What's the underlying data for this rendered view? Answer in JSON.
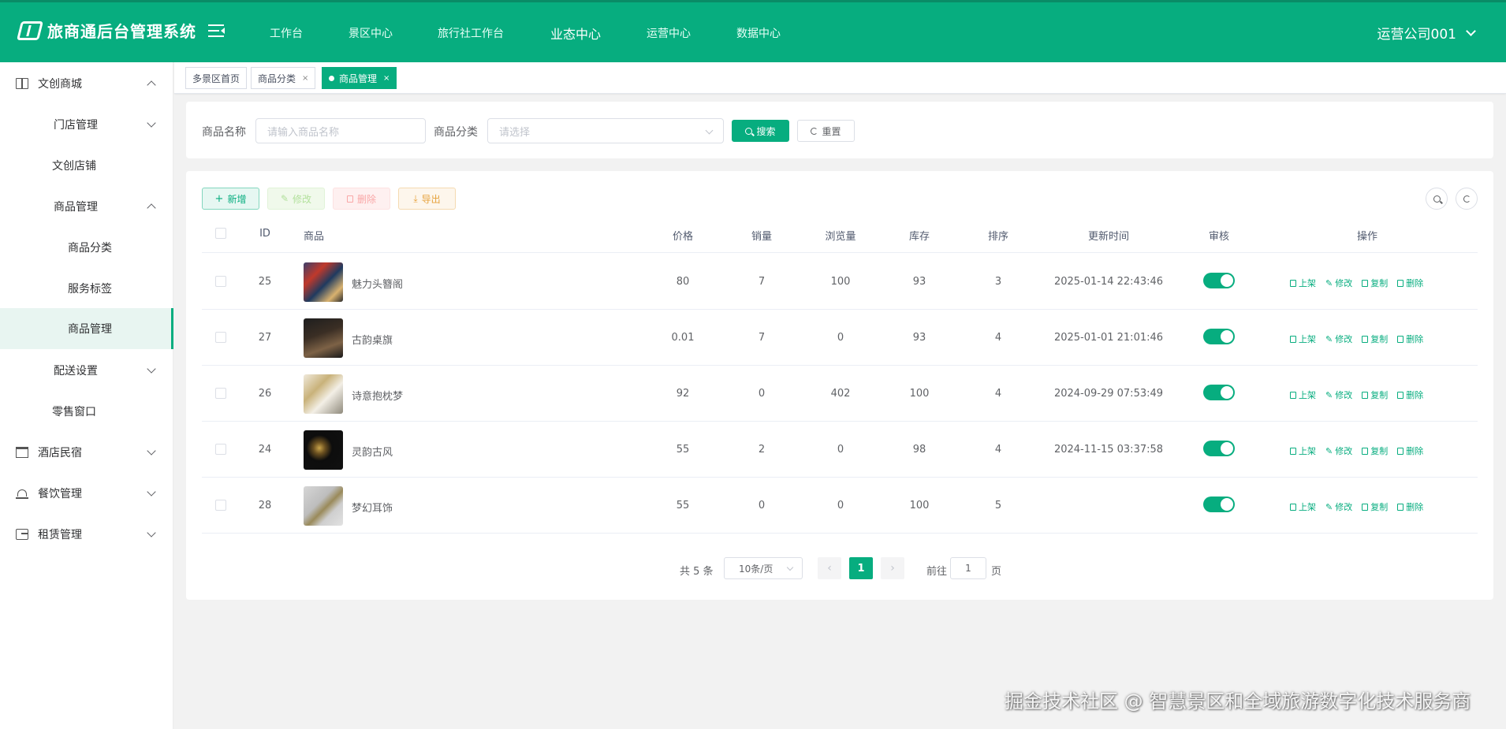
{
  "header": {
    "logo_text": "旅商通后台管理系统",
    "nav": [
      {
        "label": "工作台"
      },
      {
        "label": "景区中心"
      },
      {
        "label": "旅行社工作台"
      },
      {
        "label": "业态中心",
        "active": true
      },
      {
        "label": "运营中心"
      },
      {
        "label": "数据中心"
      }
    ],
    "user": "运营公司001"
  },
  "sidebar": {
    "items": [
      {
        "label": "文创商城",
        "icon": "book-icon",
        "expanded": true
      },
      {
        "label": "门店管理",
        "expanded": false
      },
      {
        "label": "文创店铺"
      },
      {
        "label": "商品管理",
        "expanded": true
      },
      {
        "label": "商品分类"
      },
      {
        "label": "服务标签"
      },
      {
        "label": "商品管理",
        "active": true
      },
      {
        "label": "配送设置",
        "expanded": false
      },
      {
        "label": "零售窗口"
      },
      {
        "label": "酒店民宿",
        "icon": "hotel-icon",
        "expanded": false
      },
      {
        "label": "餐饮管理",
        "icon": "dining-icon",
        "expanded": false
      },
      {
        "label": "租赁管理",
        "icon": "rent-icon",
        "expanded": false
      }
    ]
  },
  "tabs": [
    {
      "label": "多景区首页"
    },
    {
      "label": "商品分类",
      "close": "×"
    },
    {
      "label": "商品管理",
      "close": "×",
      "active": true
    }
  ],
  "search": {
    "name_label": "商品名称",
    "name_placeholder": "请输入商品名称",
    "category_label": "商品分类",
    "category_placeholder": "请选择",
    "search_button": "搜索",
    "reset_button": "重置"
  },
  "toolbar": {
    "add": "新增",
    "edit": "修改",
    "delete": "删除",
    "export": "导出"
  },
  "table": {
    "columns": {
      "id": "ID",
      "product": "商品",
      "price": "价格",
      "sales": "销量",
      "views": "浏览量",
      "stock": "库存",
      "sort": "排序",
      "updated": "更新时间",
      "review": "审核",
      "actions": "操作"
    },
    "rows": [
      {
        "id": "25",
        "name": "魅力头簪阁",
        "price": "80",
        "sales": "7",
        "views": "100",
        "stock": "93",
        "sort": "3",
        "updated": "2025-01-14 22:43:46",
        "approved": true
      },
      {
        "id": "27",
        "name": "古韵桌旗",
        "price": "0.01",
        "sales": "7",
        "views": "0",
        "stock": "93",
        "sort": "4",
        "updated": "2025-01-01 21:01:46",
        "approved": true
      },
      {
        "id": "26",
        "name": "诗意抱枕梦",
        "price": "92",
        "sales": "0",
        "views": "402",
        "stock": "100",
        "sort": "4",
        "updated": "2024-09-29 07:53:49",
        "approved": true
      },
      {
        "id": "24",
        "name": "灵韵古风",
        "price": "55",
        "sales": "2",
        "views": "0",
        "stock": "98",
        "sort": "4",
        "updated": "2024-11-15 03:37:58",
        "approved": true
      },
      {
        "id": "28",
        "name": "梦幻耳饰",
        "price": "55",
        "sales": "0",
        "views": "0",
        "stock": "100",
        "sort": "5",
        "updated": "",
        "approved": true
      }
    ],
    "row_actions": {
      "publish": "上架",
      "edit": "修改",
      "copy": "复制",
      "delete": "删除"
    }
  },
  "pagination": {
    "total": "共 5 条",
    "page_size": "10条/页",
    "current": "1",
    "goto_label": "前往",
    "goto_value": "1",
    "page_suffix": "页",
    "prev": "‹",
    "next": "›"
  },
  "watermark": "掘金技术社区 @ 智慧景区和全域旅游数字化技术服务商",
  "colors": {
    "primary": "#07ad7f",
    "header": "#07ad7f"
  }
}
